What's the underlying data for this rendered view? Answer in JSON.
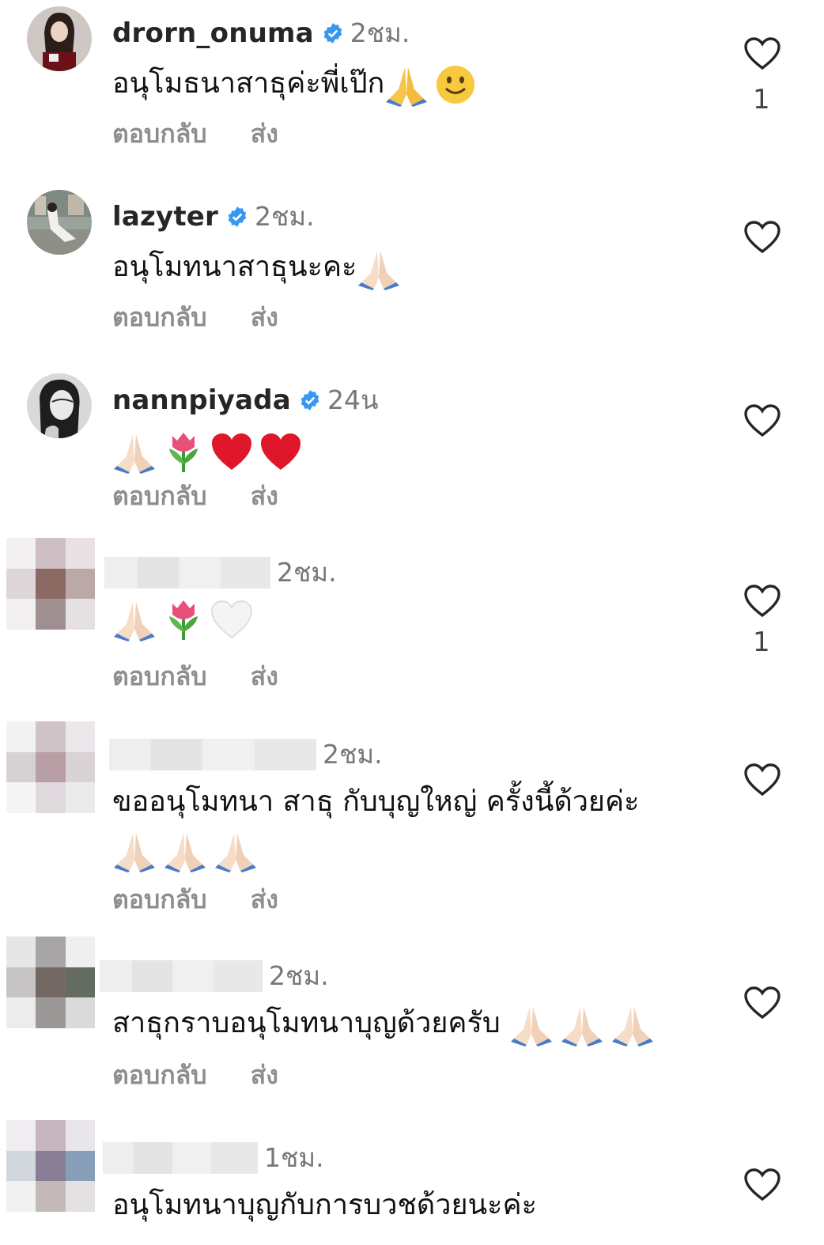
{
  "comments": [
    {
      "username": "drorn_onuma",
      "verified": true,
      "time": "2ชม.",
      "text": "อนุโมธนาสาธุค่ะพี่เป๊ก",
      "emojis": [
        "folded-hands",
        "smile"
      ],
      "likes": "1",
      "reply": "ตอบกลับ",
      "send": "ส่ง",
      "avatar": "photo-red"
    },
    {
      "username": "lazyter",
      "verified": true,
      "time": "2ชม.",
      "text": "อนุโมทนาสาธุนะคะ",
      "emojis": [
        "folded-hands"
      ],
      "likes": "",
      "reply": "ตอบกลับ",
      "send": "ส่ง",
      "avatar": "photo-white"
    },
    {
      "username": "nannpiyada",
      "verified": true,
      "time": "24น",
      "text": "",
      "emojis": [
        "folded-hands",
        "tulip",
        "red-heart",
        "red-heart"
      ],
      "likes": "",
      "reply": "ตอบกลับ",
      "send": "ส่ง",
      "avatar": "photo-bw"
    },
    {
      "username": "",
      "verified": false,
      "time": "2ชม.",
      "text": "",
      "emojis": [
        "folded-hands",
        "tulip",
        "white-heart"
      ],
      "likes": "1",
      "reply": "ตอบกลับ",
      "send": "ส่ง",
      "avatar": "pixelated"
    },
    {
      "username": "",
      "verified": false,
      "time": "2ชม.",
      "text": "ขออนุโมทนา สาธุ กับบุญใหญ่ ครั้งนี้ด้วยค่ะ",
      "emojis": [
        "folded-hands",
        "folded-hands",
        "folded-hands"
      ],
      "likes": "",
      "reply": "ตอบกลับ",
      "send": "ส่ง",
      "avatar": "pixelated"
    },
    {
      "username": "",
      "verified": false,
      "time": "2ชม.",
      "text": "สาธุกราบอนุโมทนาบุญด้วยครับ",
      "emojis": [
        "folded-hands",
        "folded-hands",
        "folded-hands"
      ],
      "likes": "",
      "reply": "ตอบกลับ",
      "send": "ส่ง",
      "avatar": "pixelated"
    },
    {
      "username": "",
      "verified": false,
      "time": "1ชม.",
      "text": "อนุโมทนาบุญกับการบวชด้วยนะค่ะ",
      "emojis": [],
      "likes": "",
      "reply": "",
      "send": "",
      "avatar": "pixelated"
    }
  ],
  "colors": {
    "verified": "#3897f0",
    "muted": "#8e8e8e",
    "heart_outline": "#262626"
  }
}
